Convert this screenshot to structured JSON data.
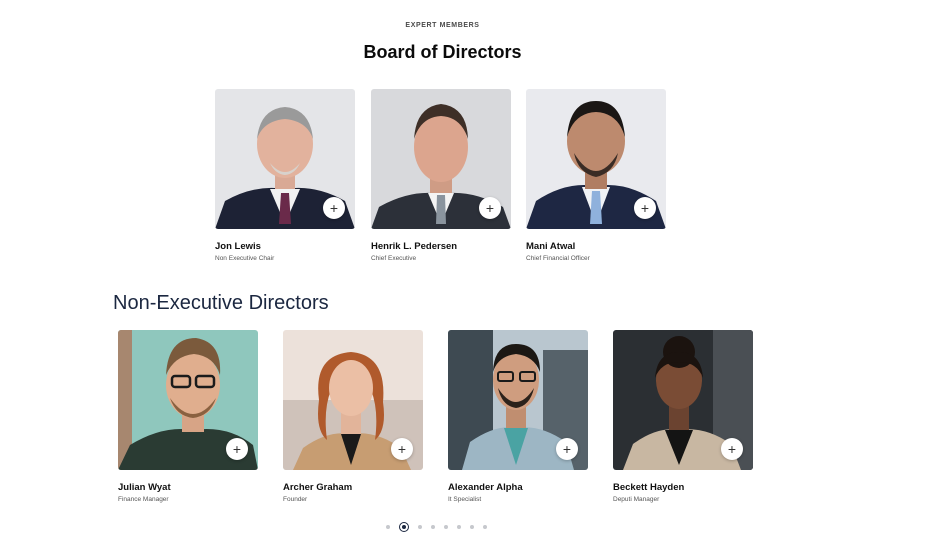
{
  "section": {
    "eyebrow": "EXPERT MEMBERS",
    "board_title": "Board of Directors",
    "non_exec_title": "Non-Executive Directors"
  },
  "board": [
    {
      "name": "Jon Lewis",
      "role": "Non Executive Chair"
    },
    {
      "name": "Henrik L. Pedersen",
      "role": "Chief Executive"
    },
    {
      "name": "Mani Atwal",
      "role": "Chief Financial Officer"
    }
  ],
  "non_exec": [
    {
      "name": "Julian Wyat",
      "role": "Finance Manager"
    },
    {
      "name": "Archer Graham",
      "role": "Founder"
    },
    {
      "name": "Alexander Alpha",
      "role": "It Specialist"
    },
    {
      "name": "Beckett Hayden",
      "role": "Deputi Manager"
    }
  ],
  "card_action_icon": "+",
  "pagination": {
    "total": 8,
    "active_index": 1
  },
  "colors": {
    "heading": "#1b2740",
    "dot_inactive": "#c6c8cd",
    "accent": "#1b2740"
  }
}
